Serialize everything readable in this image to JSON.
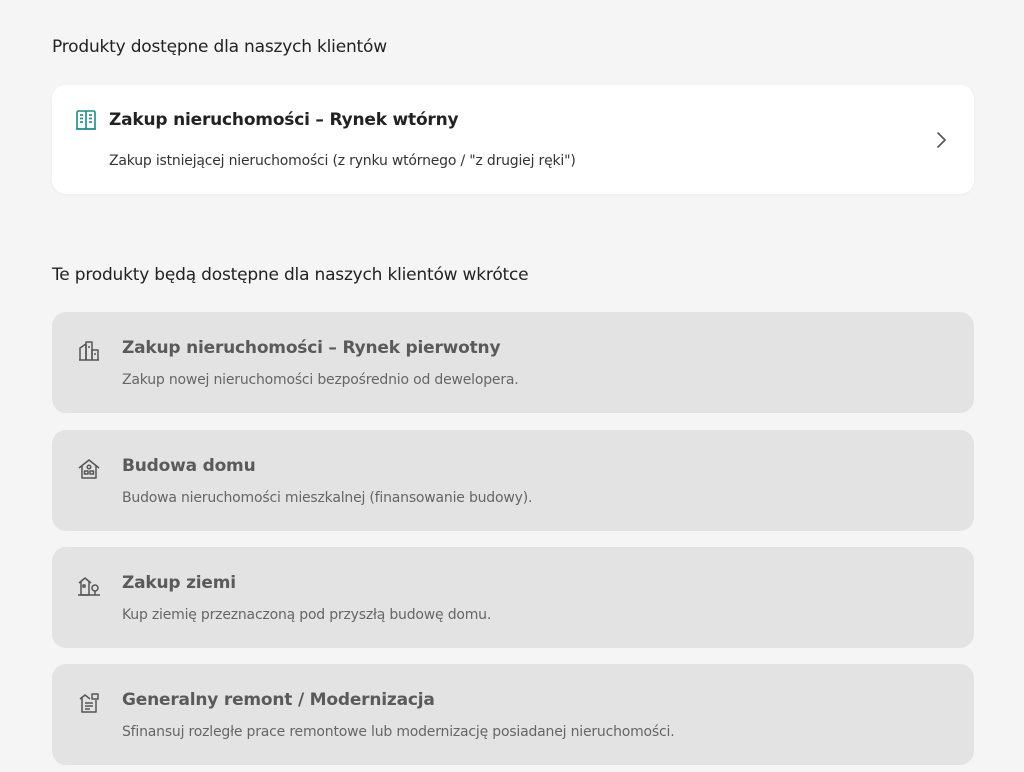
{
  "available_section": {
    "title": "Produkty dostępne dla naszych klientów",
    "items": [
      {
        "icon": "building-icon",
        "title": "Zakup nieruchomości – Rynek wtórny",
        "description": "Zakup istniejącej nieruchomości (z rynku wtórnego / \"z drugiej ręki\")"
      }
    ]
  },
  "soon_section": {
    "title": "Te produkty będą dostępne dla naszych klientów wkrótce",
    "items": [
      {
        "icon": "buildings-icon",
        "title": "Zakup nieruchomości – Rynek pierwotny",
        "description": "Zakup nowej nieruchomości bezpośrednio od dewelopera."
      },
      {
        "icon": "house-icon",
        "title": "Budowa domu",
        "description": "Budowa nieruchomości mieszkalnej (finansowanie budowy)."
      },
      {
        "icon": "land-plot-icon",
        "title": "Zakup ziemi",
        "description": "Kup ziemię przeznaczoną pod przyszłą budowę domu."
      },
      {
        "icon": "renovation-icon",
        "title": "Generalny remont / Modernizacja",
        "description": "Sfinansuj rozległe prace remontowe lub modernizację posiadanej nieruchomości."
      }
    ]
  },
  "colors": {
    "accent": "#1a8a8a",
    "page_background": "#f5f5f5",
    "card_available": "#ffffff",
    "card_disabled": "#e3e3e3"
  }
}
